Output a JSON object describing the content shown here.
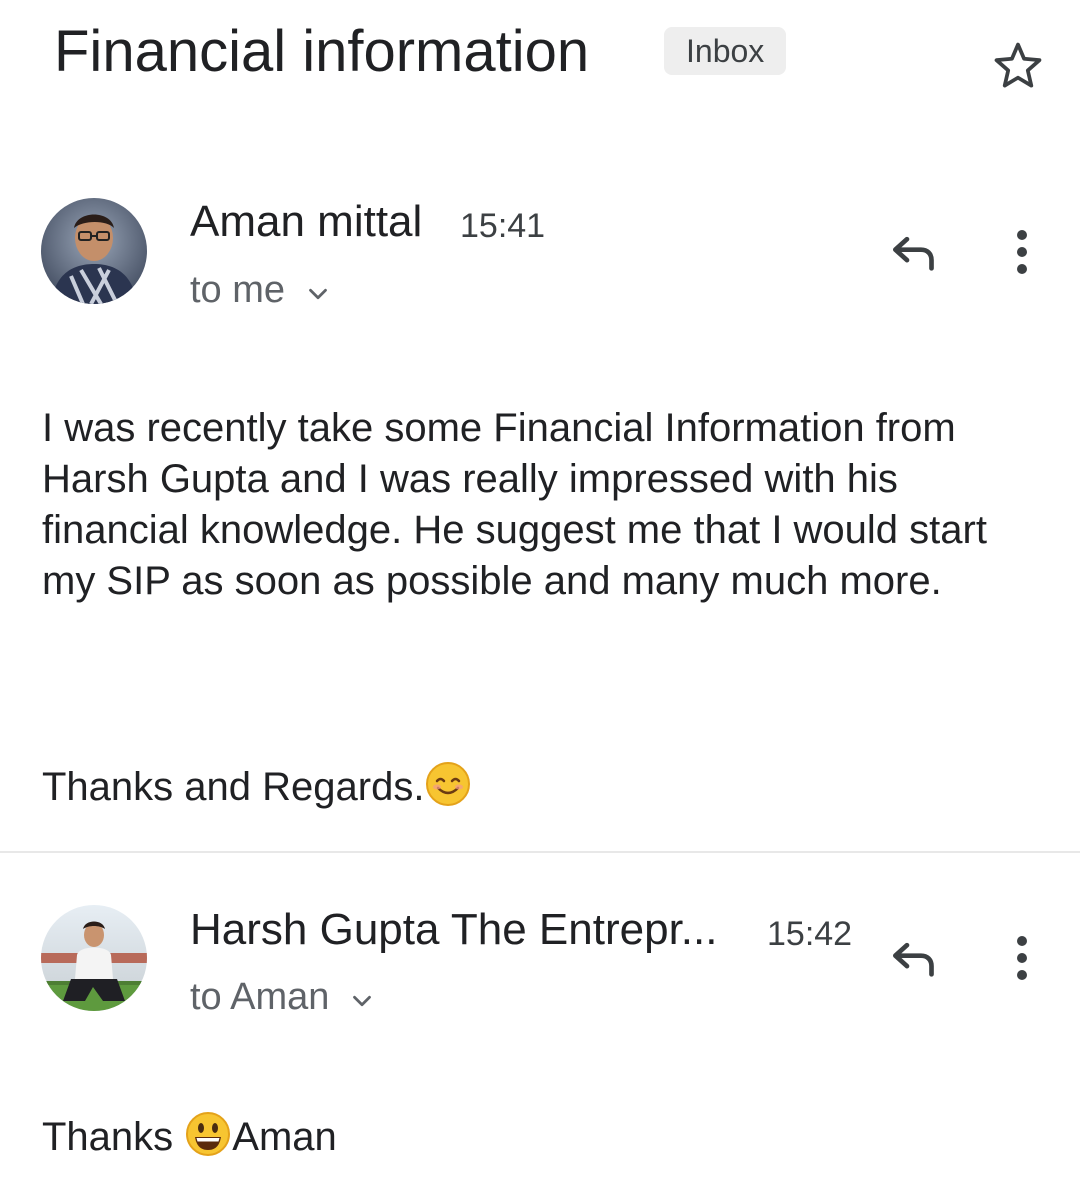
{
  "thread": {
    "subject": "Financial information",
    "label": "Inbox",
    "star_icon": "star-outline-icon"
  },
  "messages": [
    {
      "sender": "Aman mittal",
      "time": "15:41",
      "recipient": "to me",
      "body": "I was recently take some Financial Information from Harsh Gupta and I was really impressed with his financial knowledge. He suggest me that I would start my SIP as soon as possible and many much more.",
      "signoff": "Thanks and Regards.",
      "signoff_emoji": "smiling-face-emoji"
    },
    {
      "sender": "Harsh Gupta The Entrepr...",
      "time": "15:42",
      "recipient": "to Aman",
      "body_before_emoji": "Thanks ",
      "body_emoji": "grinning-face-emoji",
      "body_after_emoji": "Aman"
    }
  ],
  "colors": {
    "text_primary": "#202124",
    "text_secondary": "#5f6368",
    "chip_bg": "#eeeeee",
    "emoji_yellow": "#f7c531"
  }
}
